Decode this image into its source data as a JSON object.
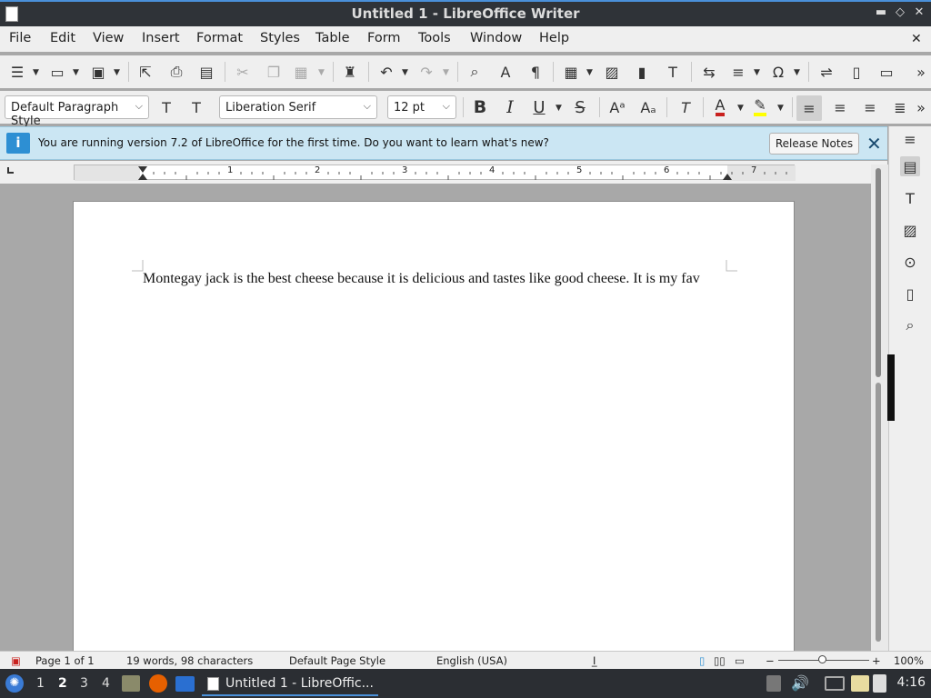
{
  "window": {
    "title": "Untitled 1 - LibreOffice Writer"
  },
  "menu": [
    "File",
    "Edit",
    "View",
    "Insert",
    "Format",
    "Styles",
    "Table",
    "Form",
    "Tools",
    "Window",
    "Help"
  ],
  "formatting": {
    "paragraph_style": "Default Paragraph Style",
    "font_name": "Liberation Serif",
    "font_size": "12 pt"
  },
  "infobar": {
    "message": "You are running version 7.2 of LibreOffice for the first time. Do you want to learn what's new?",
    "button": "Release Notes"
  },
  "ruler": {
    "numbers": [
      "1",
      "2",
      "3",
      "4",
      "5",
      "6",
      "7"
    ]
  },
  "document": {
    "text": "Montegay jack is the best cheese because it is delicious and tastes like good cheese. It is my fav"
  },
  "status": {
    "page": "Page 1 of 1",
    "words": "19 words, 98 characters",
    "page_style": "Default Page Style",
    "language": "English (USA)",
    "zoom": "100%"
  },
  "taskbar": {
    "workspaces": [
      "1",
      "2",
      "3",
      "4"
    ],
    "task_label": "Untitled 1 - LibreOffic...",
    "clock": "4:16"
  },
  "colors": {
    "accent": "#4a90d9",
    "font_color": "#c9211e",
    "highlight": "#ffff00",
    "infobar_bg": "#cbe6f3"
  }
}
